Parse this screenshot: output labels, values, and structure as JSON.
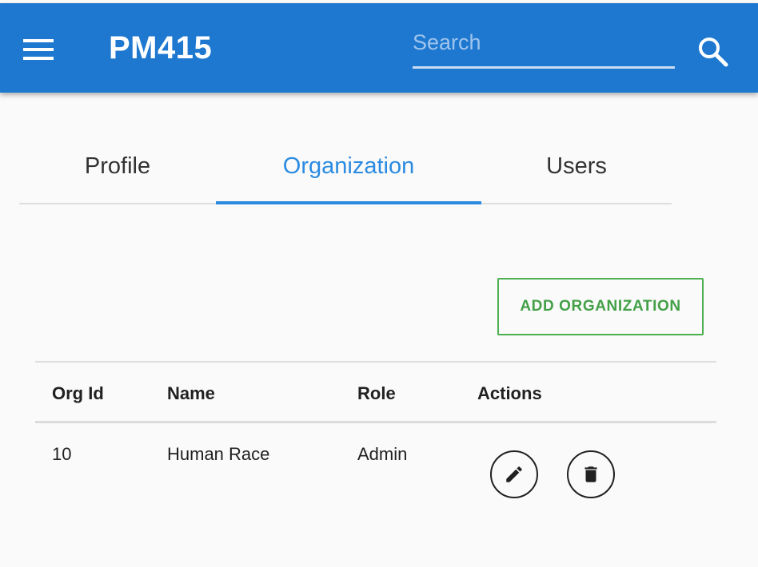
{
  "appbar": {
    "title": "PM415",
    "menu_icon": "hamburger-menu-icon",
    "search_placeholder": "Search",
    "search_value": "",
    "search_icon": "magnifier-icon",
    "color": "#1e78d0"
  },
  "tabs": {
    "items": [
      {
        "label": "Profile",
        "active": false
      },
      {
        "label": "Organization",
        "active": true
      },
      {
        "label": "Users",
        "active": false
      }
    ],
    "active_color": "#2b8be0"
  },
  "toolbar": {
    "add_label": "ADD ORGANIZATION",
    "add_color": "#43a047"
  },
  "table": {
    "columns": [
      "Org Id",
      "Name",
      "Role",
      "Actions"
    ],
    "rows": [
      {
        "org_id": "10",
        "name": "Human Race",
        "role": "Admin",
        "actions": [
          "pencil-edit-icon",
          "trash-delete-icon"
        ]
      }
    ]
  }
}
